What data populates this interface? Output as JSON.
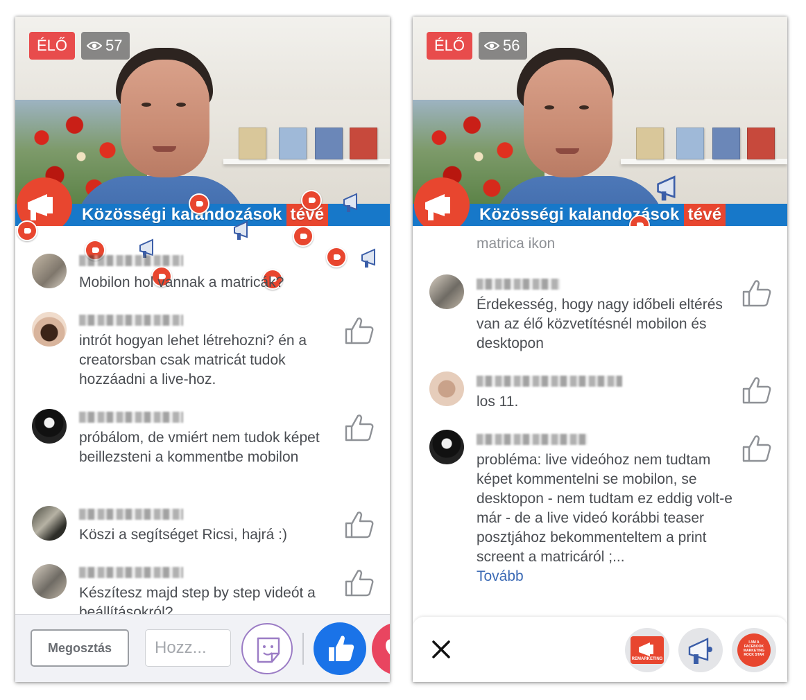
{
  "left": {
    "live_label": "ÉLŐ",
    "viewer_count": "57",
    "banner_title": "Közösségi kalandozások",
    "banner_suffix": "tévé",
    "comments": [
      {
        "text": "Mobilon hol vannak a matricák?"
      },
      {
        "text": "intrót hogyan lehet létrehozni? én a creatorsban csak matricát tudok hozzáadni a live-hoz."
      },
      {
        "text": "próbálom, de vmiért nem tudok képet beillezsteni a kommentbe mobilon"
      },
      {
        "text": "Köszi a segítséget Ricsi, hajrá :)"
      },
      {
        "text": "Készítesz majd step by step videót a beállításokról?"
      }
    ],
    "share_label": "Megosztás",
    "comment_placeholder": "Hozz..."
  },
  "right": {
    "live_label": "ÉLŐ",
    "viewer_count": "56",
    "banner_title": "Közösségi kalandozások",
    "banner_suffix": "tévé",
    "partial_comment": "matrica ikon",
    "comments": [
      {
        "text": "Érdekesség, hogy nagy időbeli eltérés van az élő közvetítésnél mobilon és desktopon"
      },
      {
        "text": "los 11."
      },
      {
        "text": "probléma: live videóhoz nem tudtam képet kommentelni se mobilon, se desktopon - nem tudtam ez eddig volt-e már - de a live videó korábbi teaser posztjához bekommenteltem a print screent a matricáról ;..."
      }
    ],
    "more_link": "Tovább",
    "stickers": [
      "REMARKETING",
      "",
      "I AM A FACEBOOK MARKETING ROCK STAR"
    ]
  },
  "colors": {
    "live_red": "#e84c4c",
    "facebook_blue": "#1a73e8",
    "banner_blue": "#1778c9",
    "banner_orange": "#e8462f",
    "link_blue": "#3b6ab5",
    "text_gray": "#4a4d52"
  },
  "icons": [
    "eye-icon",
    "like-icon",
    "sticker-icon",
    "thumbs-up-icon",
    "heart-icon",
    "close-icon",
    "megaphone-icon"
  ]
}
